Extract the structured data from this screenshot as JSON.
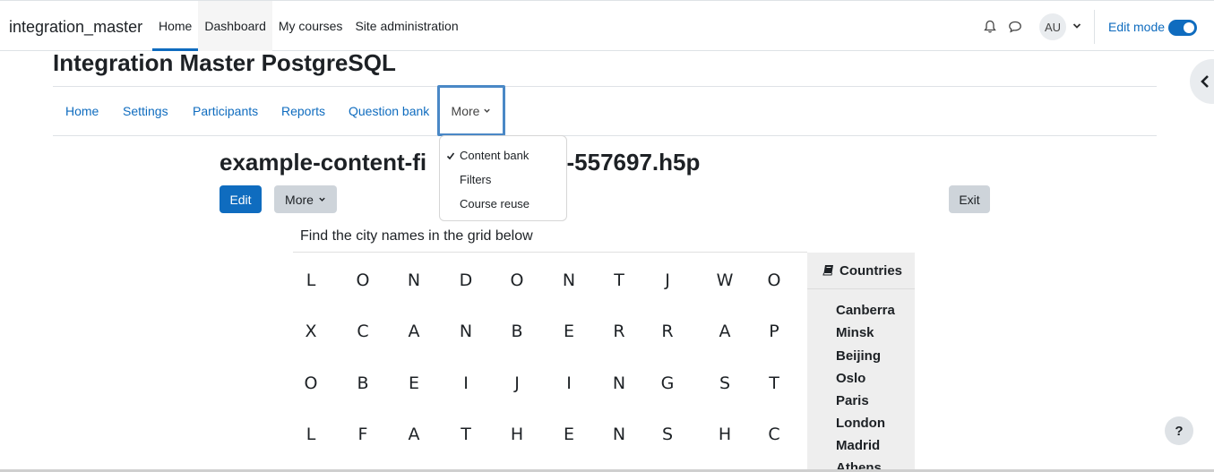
{
  "navbar": {
    "brand": "integration_master",
    "items": [
      {
        "label": "Home"
      },
      {
        "label": "Dashboard"
      },
      {
        "label": "My courses"
      },
      {
        "label": "Site administration"
      }
    ],
    "user_initials": "AU",
    "edit_mode_label": "Edit mode",
    "edit_mode_on": true
  },
  "course": {
    "title": "Integration Master PostgreSQL",
    "secondary_nav": [
      {
        "label": "Home"
      },
      {
        "label": "Settings"
      },
      {
        "label": "Participants"
      },
      {
        "label": "Reports"
      },
      {
        "label": "Question bank"
      }
    ],
    "more_label": "More",
    "dropdown": [
      {
        "label": "Content bank",
        "selected": true
      },
      {
        "label": "Filters"
      },
      {
        "label": "Course reuse"
      }
    ]
  },
  "content": {
    "title_left": "example-content-fi",
    "title_right": "ds-557697.h5p",
    "edit_label": "Edit",
    "more_label": "More",
    "exit_label": "Exit"
  },
  "h5p": {
    "instruction": "Find the city names in the grid below",
    "grid": [
      [
        "L",
        "O",
        "N",
        "D",
        "O",
        "N",
        "T",
        "J",
        "W",
        "O"
      ],
      [
        "X",
        "C",
        "A",
        "N",
        "B",
        "E",
        "R",
        "R",
        "A",
        "P"
      ],
      [
        "O",
        "B",
        "E",
        "I",
        "J",
        "I",
        "N",
        "G",
        "S",
        "T"
      ],
      [
        "L",
        "F",
        "A",
        "T",
        "H",
        "E",
        "N",
        "S",
        "H",
        "C"
      ]
    ],
    "vocab_title": "Countries",
    "words": [
      "Canberra",
      "Minsk",
      "Beijing",
      "Oslo",
      "Paris",
      "London",
      "Madrid",
      "Athens"
    ]
  },
  "help_label": "?",
  "colors": {
    "primary": "#0f6cbf",
    "secondary_btn": "#ced4da",
    "panel": "#eeeeee"
  }
}
